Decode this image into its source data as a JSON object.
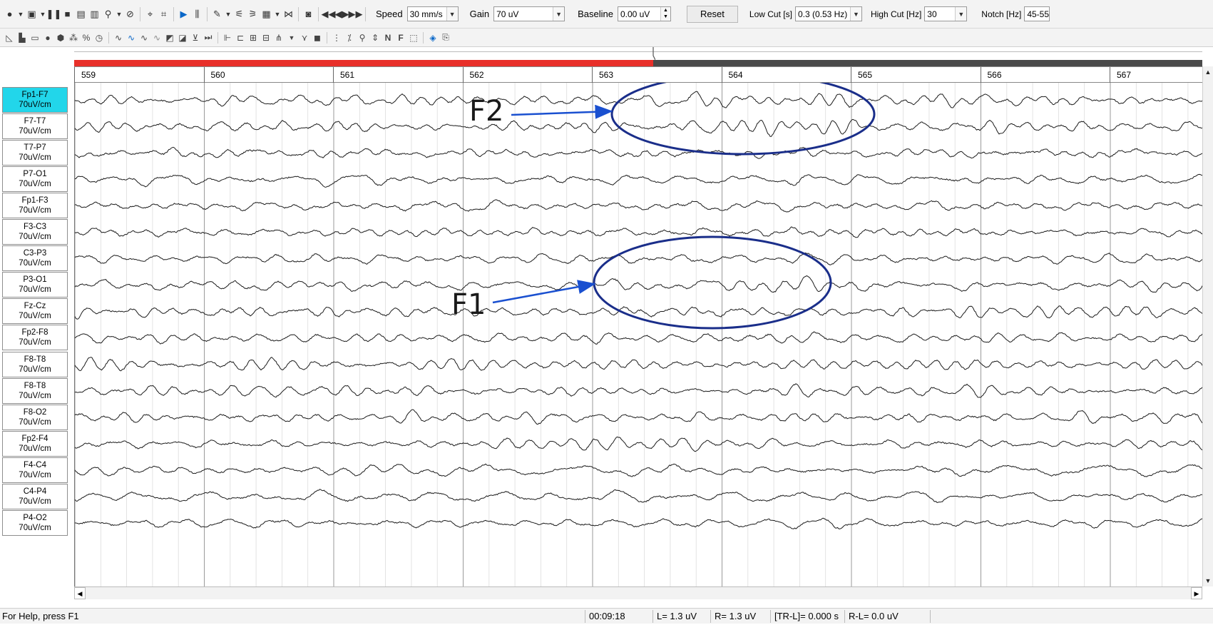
{
  "toolbar": {
    "speed": {
      "label": "Speed",
      "value": "30 mm/s"
    },
    "gain": {
      "label": "Gain",
      "value": "70 uV"
    },
    "baseline": {
      "label": "Baseline",
      "value": "0.00 uV"
    },
    "reset_label": "Reset",
    "low_cut": {
      "label": "Low Cut [s]",
      "value": "0.3 (0.53 Hz)"
    },
    "high_cut": {
      "label": "High Cut [Hz]",
      "value": "30"
    },
    "notch": {
      "label": "Notch [Hz]",
      "value": "45-55"
    }
  },
  "channels": [
    {
      "name": "Fp1-F7",
      "scale": "70uV/cm",
      "active": true
    },
    {
      "name": "F7-T7",
      "scale": "70uV/cm"
    },
    {
      "name": "T7-P7",
      "scale": "70uV/cm"
    },
    {
      "name": "P7-O1",
      "scale": "70uV/cm"
    },
    {
      "name": "Fp1-F3",
      "scale": "70uV/cm"
    },
    {
      "name": "F3-C3",
      "scale": "70uV/cm"
    },
    {
      "name": "C3-P3",
      "scale": "70uV/cm"
    },
    {
      "name": "P3-O1",
      "scale": "70uV/cm"
    },
    {
      "name": "Fz-Cz",
      "scale": "70uV/cm"
    },
    {
      "name": "Fp2-F8",
      "scale": "70uV/cm"
    },
    {
      "name": "F8-T8",
      "scale": "70uV/cm"
    },
    {
      "name": "F8-T8",
      "scale": "70uV/cm"
    },
    {
      "name": "F8-O2",
      "scale": "70uV/cm"
    },
    {
      "name": "Fp2-F4",
      "scale": "70uV/cm"
    },
    {
      "name": "F4-C4",
      "scale": "70uV/cm"
    },
    {
      "name": "C4-P4",
      "scale": "70uV/cm"
    },
    {
      "name": "P4-O2",
      "scale": "70uV/cm"
    }
  ],
  "timeline": {
    "seconds": [
      "559",
      "560",
      "561",
      "562",
      "563",
      "564",
      "565",
      "566",
      "567"
    ],
    "progress_fraction": 0.513,
    "colors": {
      "played": "#e8302a",
      "remaining": "#4a4a4a"
    }
  },
  "annotations": [
    {
      "label": "F2",
      "channels": [
        0,
        1
      ],
      "color": "#1a2e8a"
    },
    {
      "label": "F1",
      "channels": [
        7,
        8
      ],
      "color": "#1a2e8a"
    }
  ],
  "status": {
    "help": "For Help, press F1",
    "time": "00:09:18",
    "L": "L=    1.3 uV",
    "R": "R=    1.3 uV",
    "TR_L": "[TR-L]= 0.000 s",
    "R_L": "R-L=       0.0 uV"
  }
}
